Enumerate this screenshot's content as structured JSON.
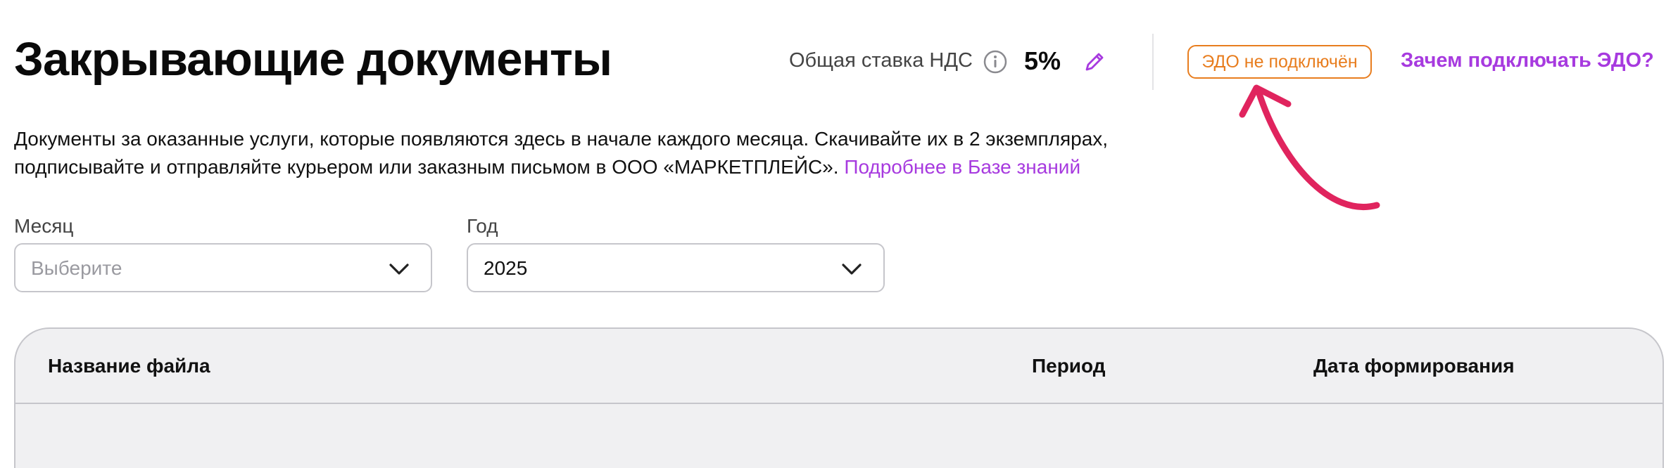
{
  "header": {
    "title": "Закрывающие документы",
    "vat_label": "Общая ставка НДС",
    "vat_value": "5%",
    "edo_status": "ЭДО не подключён",
    "edo_why_link": "Зачем подключать ЭДО?"
  },
  "description": {
    "line1": "Документы за оказанные услуги, которые появляются здесь в начале каждого месяца. Скачивайте их в 2 экземплярах,",
    "line2": "подписывайте и отправляйте курьером или заказным письмом в ООО «МАРКЕТПЛЕЙС».",
    "link": "Подробнее в Базе знаний"
  },
  "filters": {
    "month": {
      "label": "Месяц",
      "placeholder": "Выберите"
    },
    "year": {
      "label": "Год",
      "value": "2025"
    }
  },
  "table": {
    "columns": [
      "Название файла",
      "Период",
      "Дата формирования"
    ]
  },
  "colors": {
    "accent_purple": "#a73adf",
    "warning_orange": "#e87d1e",
    "annotation_red": "#e0245e"
  },
  "icons": [
    "info-icon",
    "pencil-icon",
    "chevron-down-icon",
    "annotation-arrow"
  ]
}
